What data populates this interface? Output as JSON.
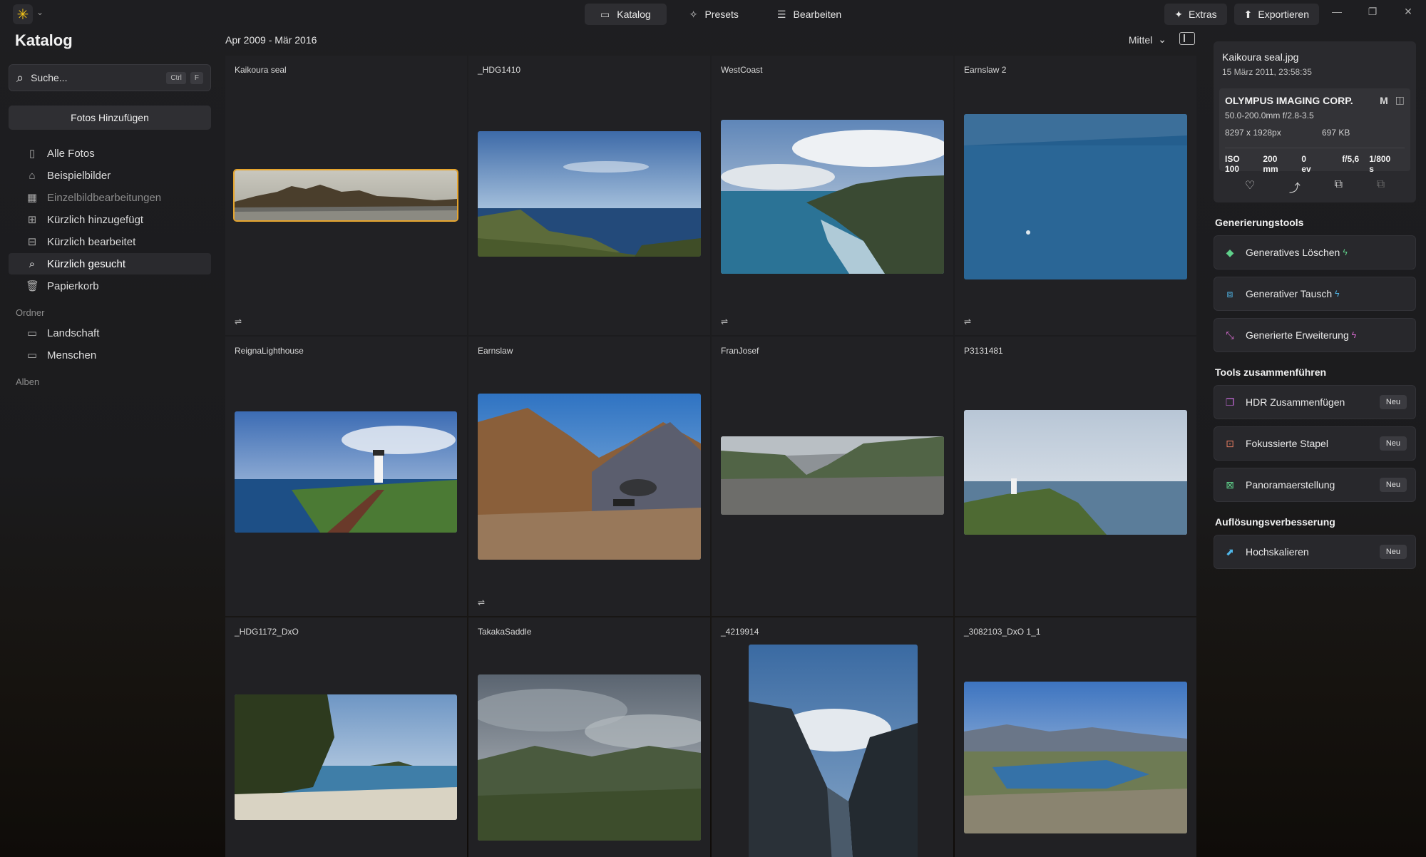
{
  "topbar": {
    "tabs": [
      {
        "label": "Katalog",
        "icon": "folder-icon",
        "active": true
      },
      {
        "label": "Presets",
        "icon": "sparkle-icon",
        "active": false
      },
      {
        "label": "Bearbeiten",
        "icon": "sliders-icon",
        "active": false
      }
    ],
    "extras_label": "Extras",
    "export_label": "Exportieren"
  },
  "sidebar": {
    "title": "Katalog",
    "search_placeholder": "Suche...",
    "search_kbd_1": "Ctrl",
    "search_kbd_2": "F",
    "add_photos_label": "Fotos Hinzufügen",
    "items": [
      {
        "label": "Alle Fotos",
        "icon": "photos-icon"
      },
      {
        "label": "Beispielbilder",
        "icon": "graduation-cap-icon"
      },
      {
        "label": "Einzelbildbearbeitungen",
        "icon": "grid-icon"
      },
      {
        "label": "Kürzlich hinzugefügt",
        "icon": "recent-add-icon"
      },
      {
        "label": "Kürzlich bearbeitet",
        "icon": "recent-edit-icon"
      },
      {
        "label": "Kürzlich gesucht",
        "icon": "search-icon"
      },
      {
        "label": "Papierkorb",
        "icon": "trash-icon"
      }
    ],
    "folders_heading": "Ordner",
    "folders": [
      {
        "label": "Landschaft",
        "icon": "folder-icon"
      },
      {
        "label": "Menschen",
        "icon": "folder-icon"
      }
    ],
    "albums_heading": "Alben"
  },
  "main": {
    "date_range": "Apr 2009 - Mär 2016",
    "size_select": "Mittel",
    "photos": [
      {
        "name": "Kaikoura seal",
        "edited": true,
        "selected": true
      },
      {
        "name": "_HDG1410",
        "edited": false
      },
      {
        "name": "WestCoast",
        "edited": true
      },
      {
        "name": "Earnslaw 2",
        "edited": true
      },
      {
        "name": "ReignaLighthouse",
        "edited": false
      },
      {
        "name": "Earnslaw",
        "edited": true
      },
      {
        "name": "FranJosef",
        "edited": false
      },
      {
        "name": "P3131481",
        "edited": false
      },
      {
        "name": "_HDG1172_DxO",
        "edited": false
      },
      {
        "name": "TakakaSaddle",
        "edited": false
      },
      {
        "name": "_4219914",
        "edited": false
      },
      {
        "name": "_3082103_DxO 1_1",
        "edited": false
      }
    ]
  },
  "info": {
    "filename": "Kaikoura seal.jpg",
    "datetime": "15 März 2011, 23:58:35",
    "camera": "OLYMPUS IMAGING CORP.",
    "mode": "M",
    "lens": "50.0-200.0mm f/2.8-3.5",
    "dimensions": "8297 x 1928px",
    "filesize": "697 KB",
    "iso": "ISO 100",
    "focal": "200 mm",
    "ev": "0 ev",
    "aperture": "f/5,6",
    "shutter": "1/800 s"
  },
  "tools": {
    "gen_heading": "Generierungstools",
    "gen": [
      {
        "label": "Generatives Löschen",
        "icon": "eraser-icon",
        "color": "#5fd08a"
      },
      {
        "label": "Generativer Tausch",
        "icon": "swap-icon",
        "color": "#4fb6e8"
      },
      {
        "label": "Generierte Erweiterung",
        "icon": "expand-icon",
        "color": "#d86bd0"
      }
    ],
    "merge_heading": "Tools zusammenführen",
    "merge": [
      {
        "label": "HDR Zusammenfügen",
        "icon": "hdr-icon",
        "badge": "Neu",
        "color": "#c46ad8"
      },
      {
        "label": "Fokussierte Stapel",
        "icon": "focus-stack-icon",
        "badge": "Neu",
        "color": "#e07a5f"
      },
      {
        "label": "Panoramaerstellung",
        "icon": "panorama-icon",
        "badge": "Neu",
        "color": "#5fd08a"
      }
    ],
    "upscale_heading": "Auflösungsverbesserung",
    "upscale": [
      {
        "label": "Hochskalieren",
        "icon": "upscale-icon",
        "badge": "Neu",
        "color": "#4fb6e8"
      }
    ]
  }
}
